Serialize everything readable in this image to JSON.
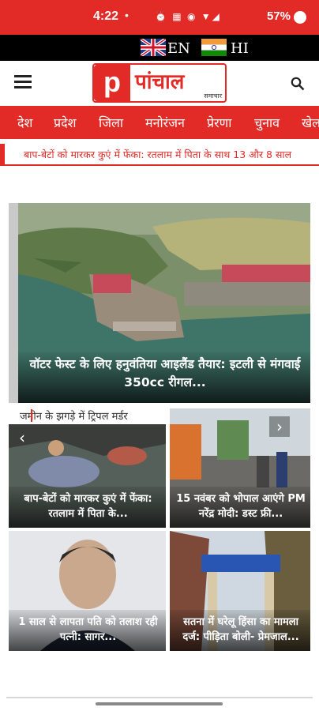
{
  "status_bar": {
    "time": "4:22",
    "dot": "•",
    "icons": "⏰ ▦ ◉ ▼◢",
    "battery": "57%"
  },
  "language_bar": {
    "options": [
      {
        "label": "EN",
        "flag": "uk-flag-icon"
      },
      {
        "label": "HI",
        "flag": "india-flag-icon"
      }
    ]
  },
  "header": {
    "logo_letter": "p",
    "logo_name": "पांचाल",
    "logo_sub": "समाचार",
    "menu_icon": "hamburger-menu-icon",
    "search_icon": "search-icon"
  },
  "nav": {
    "items": [
      "देश",
      "प्रदेश",
      "जिला",
      "मनोरंजन",
      "प्रेरणा",
      "चुनाव",
      "खेल"
    ]
  },
  "ticker": {
    "text": "बाप-बेटों को मारकर कुएं में फेंका: रतलाम में पिता के साथ 13 और 8 साल"
  },
  "hero": {
    "title": "वॉटर फेस्ट के लिए हनुवंतिया आइलैंड तैयार: इटली से मंगवाई 350cc रीगल..."
  },
  "breaking_strip": {
    "text": "जमीन के झगड़े में ट्रिपल मर्डर"
  },
  "cards": [
    {
      "title": "बाप-बेटों को मारकर कुएं में फेंका: रतलाम में पिता के..."
    },
    {
      "title": "15 नवंबर को भोपाल आएंगे PM नरेंद्र मोदी: डस्ट फ्री..."
    },
    {
      "title": "1 साल से लापता पति को तलाश रही पत्नी: सागर..."
    },
    {
      "title": "सतना में घरेलू हिंसा का मामला दर्ज: पीड़िता बोली- प्रेमजाल..."
    }
  ],
  "colors": {
    "brand_red": "#e22a26",
    "black": "#000000"
  }
}
